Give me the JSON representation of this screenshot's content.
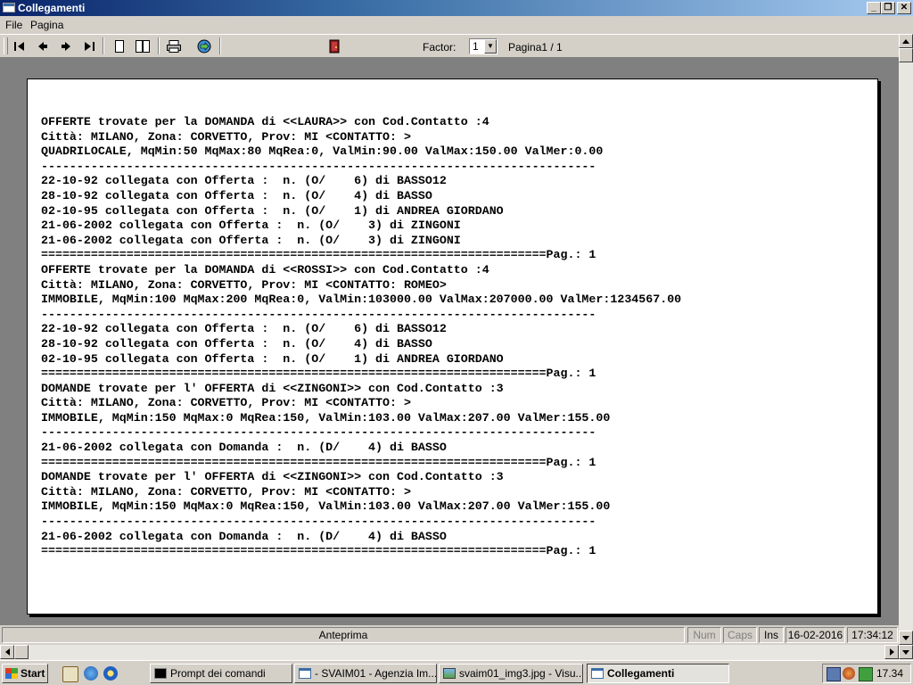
{
  "window": {
    "title": "Collegamenti"
  },
  "menu": [
    "File",
    "Pagina"
  ],
  "toolbar": {
    "factor_label": "Factor:",
    "factor_value": "1",
    "page_label": "Pagina1 / 1",
    "buttons": [
      "first-page-icon",
      "prev-page-icon",
      "next-page-icon",
      "last-page-icon",
      "single-page-icon",
      "two-page-icon",
      "print-icon",
      "export-icon",
      "exit-door-icon"
    ]
  },
  "report": {
    "lines": [
      "OFFERTE trovate per la DOMANDA di <<LAURA>> con Cod.Contatto :4",
      "Città: MILANO, Zona: CORVETTO, Prov: MI <CONTATTO: >",
      "QUADRILOCALE, MqMin:50 MqMax:80 MqRea:0, ValMin:90.00 ValMax:150.00 ValMer:0.00",
      "------------------------------------------------------------------------------",
      "22-10-92 collegata con Offerta :  n. (O/    6) di BASSO12",
      "28-10-92 collegata con Offerta :  n. (O/    4) di BASSO",
      "02-10-95 collegata con Offerta :  n. (O/    1) di ANDREA GIORDANO",
      "21-06-2002 collegata con Offerta :  n. (O/    3) di ZINGONI",
      "21-06-2002 collegata con Offerta :  n. (O/    3) di ZINGONI",
      "=======================================================================Pag.: 1",
      "OFFERTE trovate per la DOMANDA di <<ROSSI>> con Cod.Contatto :4",
      "Città: MILANO, Zona: CORVETTO, Prov: MI <CONTATTO: ROMEO>",
      "IMMOBILE, MqMin:100 MqMax:200 MqRea:0, ValMin:103000.00 ValMax:207000.00 ValMer:1234567.00",
      "------------------------------------------------------------------------------",
      "22-10-92 collegata con Offerta :  n. (O/    6) di BASSO12",
      "28-10-92 collegata con Offerta :  n. (O/    4) di BASSO",
      "02-10-95 collegata con Offerta :  n. (O/    1) di ANDREA GIORDANO",
      "=======================================================================Pag.: 1",
      "DOMANDE trovate per l' OFFERTA di <<ZINGONI>> con Cod.Contatto :3",
      "Città: MILANO, Zona: CORVETTO, Prov: MI <CONTATTO: >",
      "IMMOBILE, MqMin:150 MqMax:0 MqRea:150, ValMin:103.00 ValMax:207.00 ValMer:155.00",
      "------------------------------------------------------------------------------",
      "21-06-2002 collegata con Domanda :  n. (D/    4) di BASSO",
      "=======================================================================Pag.: 1",
      "DOMANDE trovate per l' OFFERTA di <<ZINGONI>> con Cod.Contatto :3",
      "Città: MILANO, Zona: CORVETTO, Prov: MI <CONTATTO: >",
      "IMMOBILE, MqMin:150 MqMax:0 MqRea:150, ValMin:103.00 ValMax:207.00 ValMer:155.00",
      "------------------------------------------------------------------------------",
      "21-06-2002 collegata con Domanda :  n. (D/    4) di BASSO",
      "=======================================================================Pag.: 1"
    ]
  },
  "statusbar": {
    "mode": "Anteprima",
    "num": "Num",
    "caps": "Caps",
    "ins": "Ins",
    "date": "16-02-2016",
    "time": "17:34:12"
  },
  "taskbar": {
    "start_label": "Start",
    "tasks": [
      "Prompt dei comandi",
      "- SVAIM01 - Agenzia Im...",
      "svaim01_img3.jpg - Visu...",
      "Collegamenti"
    ],
    "clock": "17.34"
  }
}
